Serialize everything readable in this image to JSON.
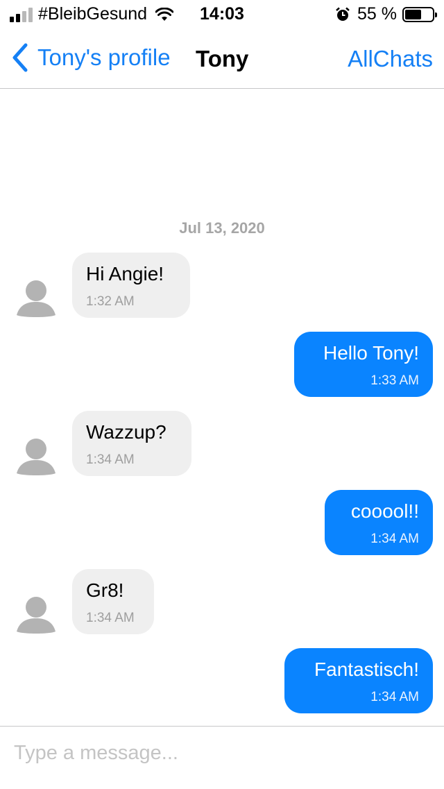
{
  "status_bar": {
    "carrier": "#BleibGesund",
    "time": "14:03",
    "battery_text": "55 %",
    "battery_level": 0.55,
    "signal_bars_filled": 2,
    "signal_bars_total": 4
  },
  "nav": {
    "back_label": "Tony's profile",
    "title": "Tony",
    "right_label": "AllChats"
  },
  "chat": {
    "date_header": "Jul 13, 2020",
    "messages": [
      {
        "direction": "in",
        "text": "Hi Angie!",
        "time": "1:32 AM"
      },
      {
        "direction": "out",
        "text": "Hello Tony!",
        "time": "1:33 AM"
      },
      {
        "direction": "in",
        "text": "Wazzup?",
        "time": "1:34 AM"
      },
      {
        "direction": "out",
        "text": "cooool!!",
        "time": "1:34 AM"
      },
      {
        "direction": "in",
        "text": "Gr8!",
        "time": "1:34 AM"
      },
      {
        "direction": "out",
        "text": "Fantastisch!",
        "time": "1:34 AM"
      }
    ]
  },
  "composer": {
    "placeholder": "Type a message...",
    "value": ""
  },
  "colors": {
    "accent": "#1580f5",
    "outgoing_bubble": "#0a84ff",
    "incoming_bubble": "#efefef",
    "avatar": "#b3b3b3"
  },
  "icons": {
    "back": "chevron-left-icon",
    "wifi": "wifi-icon",
    "alarm": "alarm-icon",
    "battery": "battery-icon",
    "signal": "signal-icon",
    "avatar": "person-avatar-icon"
  }
}
